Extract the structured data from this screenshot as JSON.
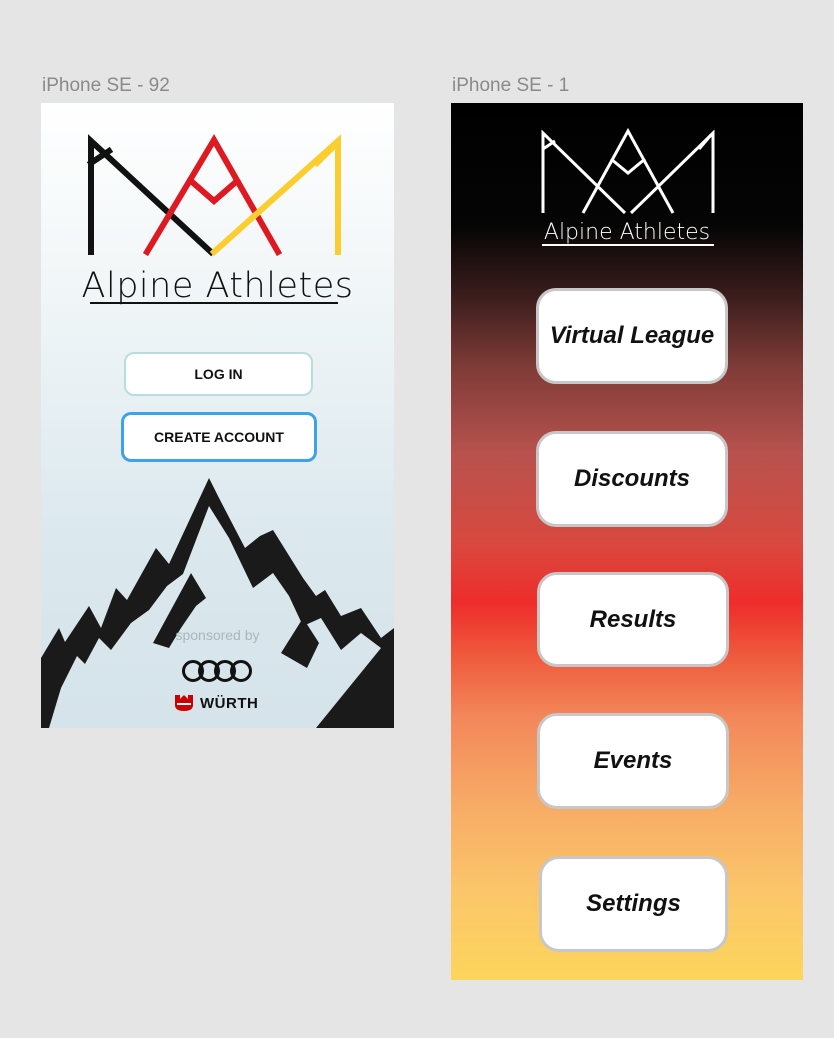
{
  "frames": {
    "login": {
      "label": "iPhone SE - 92",
      "brand": "Alpine Athletes",
      "login_button": "LOG IN",
      "create_button": "CREATE ACCOUNT",
      "sponsored_text": "sponsored by",
      "sponsor_wordmark": "WÜRTH"
    },
    "menu": {
      "label": "iPhone SE - 1",
      "brand": "Alpine Athletes",
      "buttons": [
        "Virtual League",
        "Discounts",
        "Results",
        "Events",
        "Settings"
      ]
    }
  },
  "colors": {
    "logo_black": "#111111",
    "logo_red": "#dd1a22",
    "logo_gold": "#fbcd2f",
    "create_border": "#3ea2e8",
    "login_border": "#b8dde0",
    "wurth_red": "#cc0000"
  },
  "icons": [
    "crown-logo-icon",
    "mountains-icon",
    "audi-rings-icon",
    "wurth-mark-icon"
  ]
}
